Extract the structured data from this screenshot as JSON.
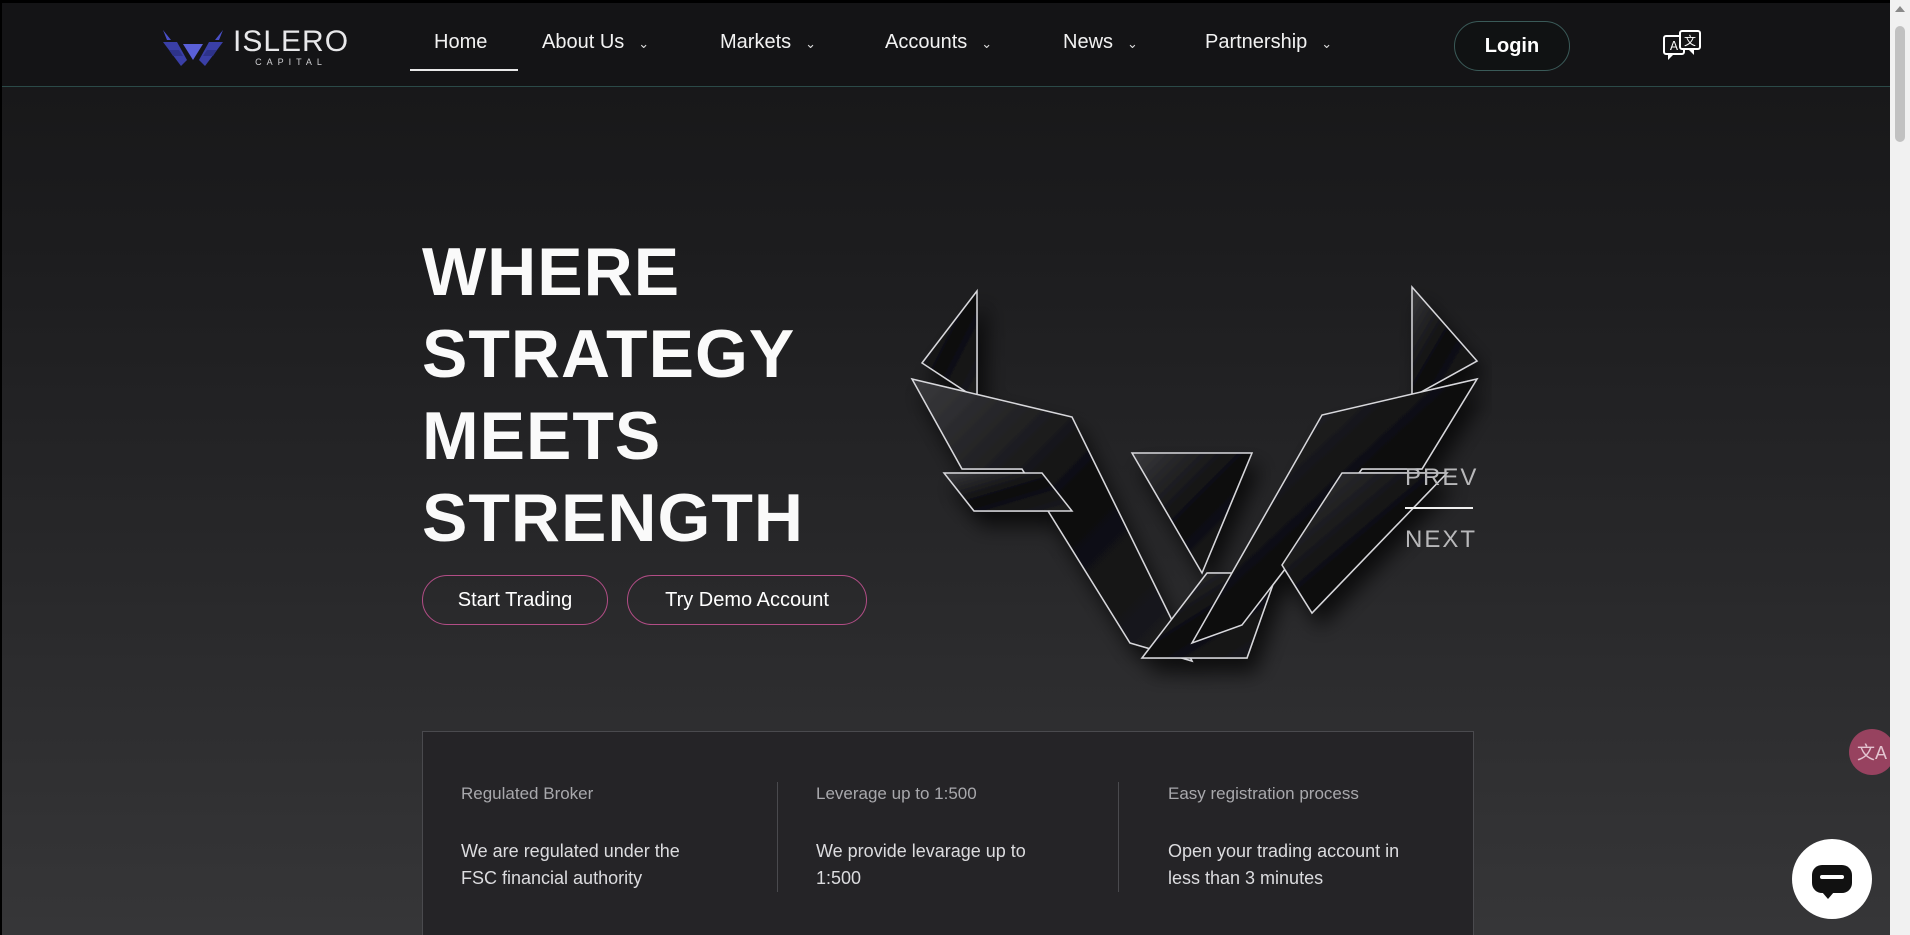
{
  "brand": {
    "name": "ISLERO",
    "sub": "CAPITAL",
    "accent": "#3a3fa6"
  },
  "nav": {
    "items": [
      {
        "label": "Home",
        "chevron": false
      },
      {
        "label": "About Us",
        "chevron": true
      },
      {
        "label": "Markets",
        "chevron": true
      },
      {
        "label": "Accounts",
        "chevron": true
      },
      {
        "label": "News",
        "chevron": true
      },
      {
        "label": "Partnership",
        "chevron": true
      }
    ],
    "login_label": "Login",
    "language_icon": "translate-icon"
  },
  "hero": {
    "title_lines": [
      "WHERE",
      "STRATEGY",
      "MEETS",
      "STRENGTH"
    ],
    "start_trading_label": "Start Trading",
    "demo_label": "Try Demo Account",
    "prev_label": "PREV",
    "next_label": "NEXT",
    "button_border_color": "#b24d86"
  },
  "features": [
    {
      "title": "Regulated Broker",
      "desc_lines": [
        "We are regulated under the",
        "FSC financial authority"
      ]
    },
    {
      "title": "Leverage up to 1:500",
      "desc_lines": [
        "We provide levarage up to",
        "1:500"
      ]
    },
    {
      "title": "Easy registration process",
      "desc_lines": [
        "Open your trading account in",
        "less than 3 minutes"
      ]
    }
  ],
  "floating": {
    "translate_icon": "translate-icon",
    "chat_icon": "chat-icon",
    "translate_color": "#a34565"
  }
}
